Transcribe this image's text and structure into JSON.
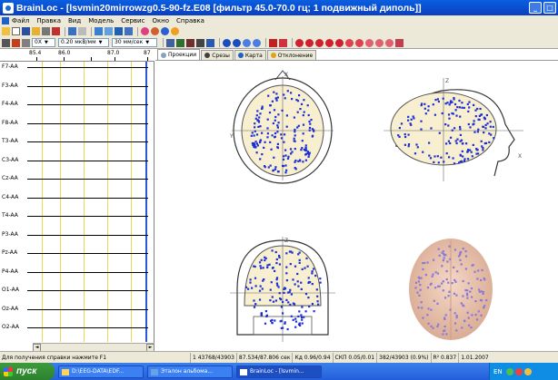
{
  "window": {
    "title": "BrainLoc - [lsvmin20mirrowzg0.5-90-fz.E08 [фильтр 45.0-70.0 гц; 1 подвижный диполь]]"
  },
  "menu": [
    "Файл",
    "Правка",
    "Вид",
    "Модель",
    "Сервис",
    "Окно",
    "Справка"
  ],
  "toolbar2": {
    "combo1": "0X",
    "combo2": "0.20 мкВ/мм",
    "combo3": "30 мм/сек"
  },
  "ruler": {
    "labels": [
      "85.4",
      "86.0",
      "87.0",
      "87"
    ]
  },
  "channels": [
    "F7-AA",
    "F3-AA",
    "F4-AA",
    "F8-AA",
    "T3-AA",
    "C3-AA",
    "Cz-AA",
    "C4-AA",
    "T4-AA",
    "P3-AA",
    "Pz-AA",
    "P4-AA",
    "O1-AA",
    "Oz-AA",
    "O2-AA"
  ],
  "tabs": [
    {
      "label": "Проекции",
      "active": true
    },
    {
      "label": "Срезы",
      "active": false
    },
    {
      "label": "Карта",
      "active": false
    },
    {
      "label": "Отклонение",
      "active": false
    }
  ],
  "axes": {
    "top": {
      "v": "Z"
    },
    "side": {
      "v": "Z"
    }
  },
  "status": {
    "help": "Для получения справки нажмите F1",
    "count": "1  43768/43903",
    "time": "87.534/87.806 сек",
    "kd": "Кд  0.96/0.94",
    "ckp": "СКП 0.05/0.01",
    "ratio": "382/43903 (0.9%)",
    "misc": "R² 0.837",
    "date": "1.01.2007"
  },
  "taskbar": {
    "start": "пуск",
    "tasks": [
      "D:\\EEG-DATA\\EDF...",
      "Эталон альбома...",
      "BrainLoc - [lsvmin..."
    ],
    "lang": "EN"
  },
  "colors": {
    "dots": "#1c2fd6",
    "accent": "#0a4fd8"
  }
}
